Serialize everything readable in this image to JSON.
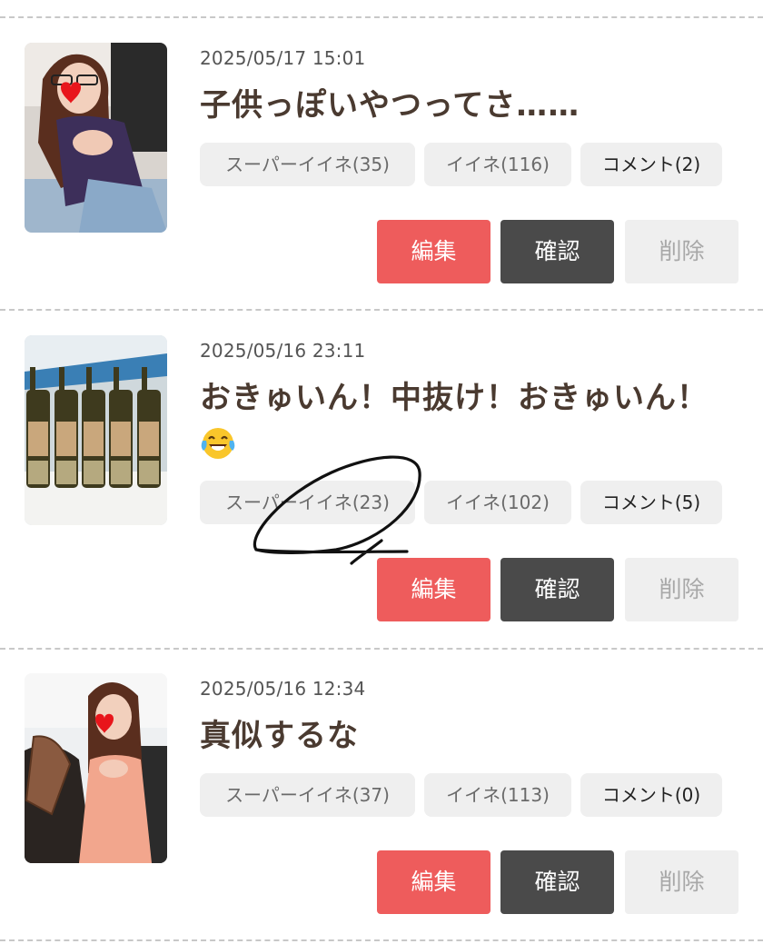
{
  "posts": [
    {
      "date": "2025/05/17 15:01",
      "title": "子供っぽいやつってさ……",
      "super_like": "スーパーイイネ(35)",
      "like": "イイネ(116)",
      "comment": "コメント(2)",
      "edit": "編集",
      "confirm": "確認",
      "delete": "削除"
    },
    {
      "date": "2025/05/16 23:11",
      "title": "おきゅいん！中抜け！おきゅいん！",
      "super_like": "スーパーイイネ(23)",
      "like": "イイネ(102)",
      "comment": "コメント(5)",
      "edit": "編集",
      "confirm": "確認",
      "delete": "削除"
    },
    {
      "date": "2025/05/16 12:34",
      "title": "真似するな",
      "super_like": "スーパーイイネ(37)",
      "like": "イイネ(113)",
      "comment": "コメント(0)",
      "edit": "編集",
      "confirm": "確認",
      "delete": "削除"
    }
  ],
  "colors": {
    "edit": "#ee5c5c",
    "confirm": "#4a4a4a",
    "delete": "#efefef",
    "chip": "#efefef",
    "title": "#4a3a30"
  },
  "icons": {
    "title_emoji": "tears-of-joy-emoji-icon",
    "thumb_overlay": "heart-sticker-icon"
  }
}
